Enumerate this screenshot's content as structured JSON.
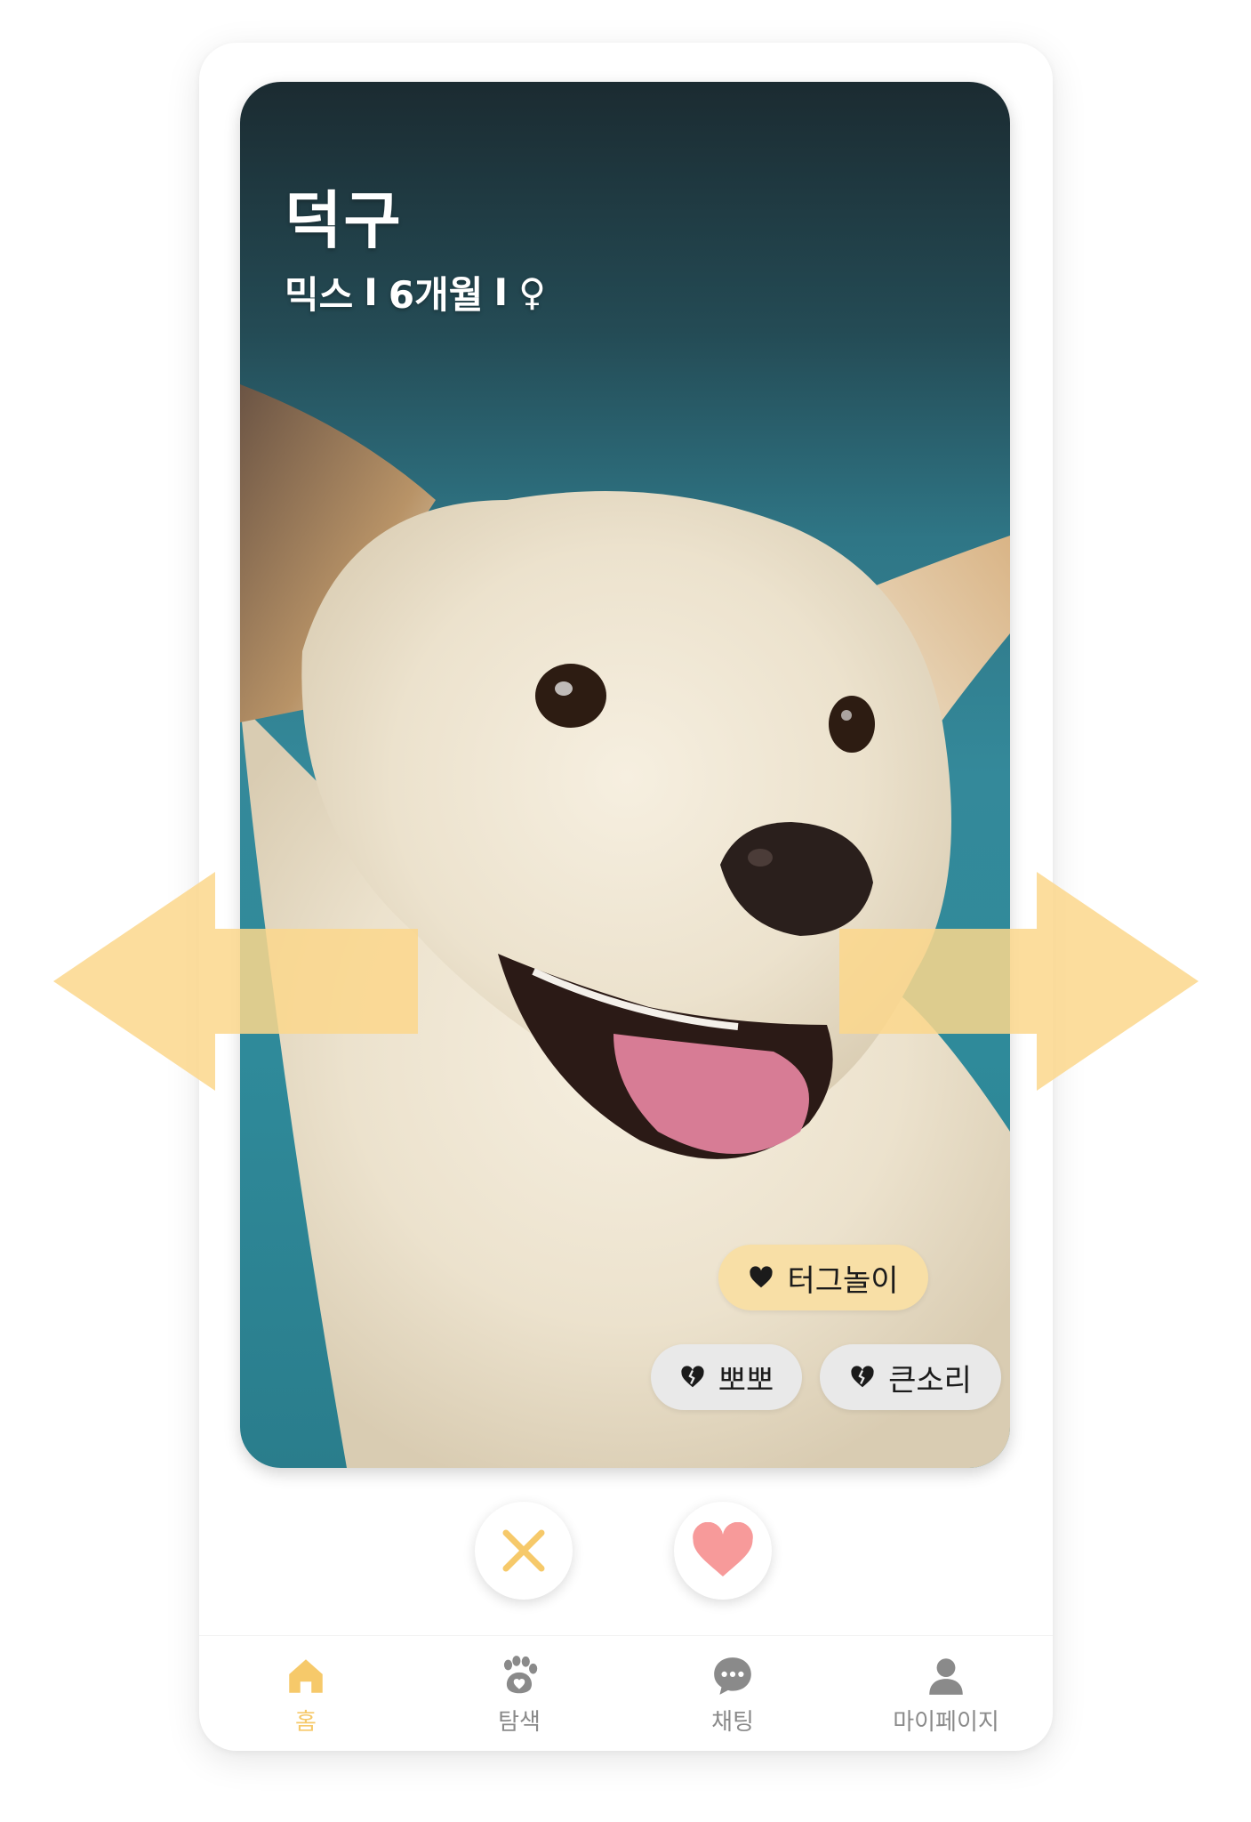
{
  "profile": {
    "name": "덕구",
    "breed": "믹스",
    "separator": "I",
    "age": "6개월",
    "gender_symbol": "♀"
  },
  "tags": {
    "likes": [
      {
        "label": "터그놀이",
        "icon": "heart-icon"
      }
    ],
    "dislikes": [
      {
        "label": "뽀뽀",
        "icon": "broken-heart-icon"
      },
      {
        "label": "큰소리",
        "icon": "broken-heart-icon"
      }
    ]
  },
  "actions": {
    "pass_icon": "close-icon",
    "like_icon": "heart-icon"
  },
  "tabbar": {
    "items": [
      {
        "label": "홈",
        "icon": "home-icon",
        "active": true
      },
      {
        "label": "탐색",
        "icon": "paw-icon",
        "active": false
      },
      {
        "label": "채팅",
        "icon": "chat-icon",
        "active": false
      },
      {
        "label": "마이페이지",
        "icon": "user-icon",
        "active": false
      }
    ]
  },
  "colors": {
    "accent": "#f6c96a",
    "like_tag_bg": "#f8dfa6",
    "dislike_tag_bg": "#e9e9e9",
    "like_button": "#f79a9a",
    "pass_button": "#f6c96a",
    "swipe_arrow": "#fcd78c",
    "tab_inactive": "#8a8a8a"
  }
}
